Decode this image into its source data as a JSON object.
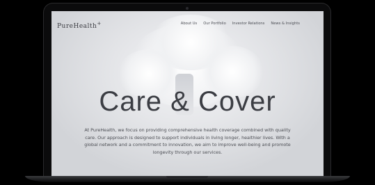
{
  "site": {
    "logo": "PureHealth",
    "logo_mark": "+"
  },
  "nav": {
    "items": [
      {
        "label": "About Us"
      },
      {
        "label": "Our Portfolio"
      },
      {
        "label": "Investor Relations"
      },
      {
        "label": "News & Insights"
      }
    ]
  },
  "hero": {
    "title": "Care & Cover",
    "body": "At PureHealth, we focus on providing comprehensive health coverage combined with quality care. Our approach is designed to support individuals in living longer, healthier lives. With a global network and a commitment to innovation, we aim to improve well-being and promote longevity through our services."
  },
  "colors": {
    "background": "#000000",
    "screen_bg": "#e6e7ea",
    "text": "#3b3d43"
  },
  "icons": [
    "camera-icon"
  ]
}
